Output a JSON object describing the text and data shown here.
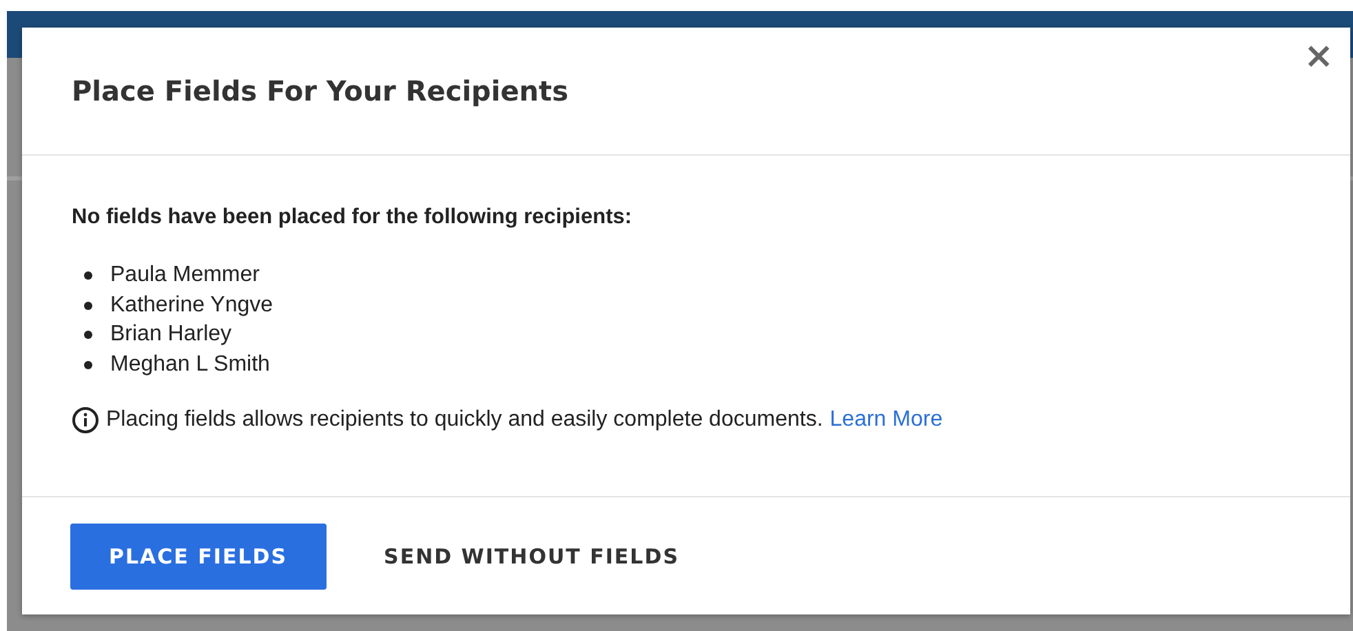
{
  "dialog": {
    "title": "Place Fields For Your Recipients",
    "close": "×"
  },
  "message": "No fields have been placed for the following recipients:",
  "recipients": [
    "Paula Memmer",
    "Katherine Yngve",
    "Brian Harley",
    "Meghan L Smith"
  ],
  "info": {
    "text": "Placing fields allows recipients to quickly and easily complete documents.",
    "link": "Learn More"
  },
  "buttons": [
    {
      "label": "PLACE FIELDS",
      "kind": "primary"
    },
    {
      "label": "SEND WITHOUT FIELDS",
      "kind": "text"
    }
  ]
}
